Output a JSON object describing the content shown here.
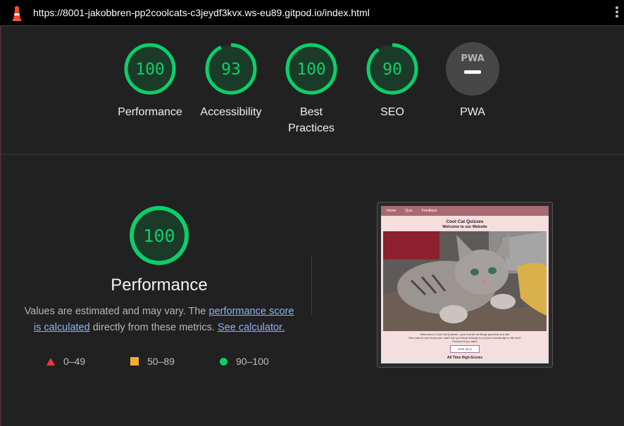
{
  "browser": {
    "url": "https://8001-jakobbren-pp2coolcats-c3jeydf3kvx.ws-eu89.gitpod.io/index.html"
  },
  "colors": {
    "pass": "#0cce6b",
    "average": "#ffaa33",
    "fail": "#ff3333",
    "background": "#212121"
  },
  "gauges": [
    {
      "score": "100",
      "value": 100,
      "label": "Performance"
    },
    {
      "score": "93",
      "value": 93,
      "label": "Accessibility"
    },
    {
      "score": "100",
      "value": 100,
      "label": "Best Practices"
    },
    {
      "score": "90",
      "value": 90,
      "label": "SEO"
    },
    {
      "score": "",
      "value": null,
      "label": "PWA",
      "badge": "PWA",
      "icon": "pwa-dash-icon"
    }
  ],
  "performance": {
    "score": "100",
    "value": 100,
    "title": "Performance",
    "desc_pre": "Values are estimated and may vary. The ",
    "link_score": "performance score is calculated",
    "desc_mid": " directly from these metrics. ",
    "link_calc": "See calculator."
  },
  "legend": [
    {
      "range": "0–49",
      "icon": "triangle-icon"
    },
    {
      "range": "50–89",
      "icon": "square-icon"
    },
    {
      "range": "90–100",
      "icon": "circle-icon"
    }
  ],
  "screenshot": {
    "nav": [
      "Home",
      "Quiz",
      "Feedback"
    ],
    "title": "Cool Cat Quizzes",
    "subtitle": "Welcome to our Website",
    "text_1": "Welcome to Cool Cat Quizzes - your hub for all things quizzical and cat!",
    "text_2": "How well do you know your cats? Are you know enough to put your knowledge to the test?",
    "text_3": "Proceed if you dare!",
    "button": "Start Quiz",
    "scores_heading": "All Time High-Scores"
  }
}
